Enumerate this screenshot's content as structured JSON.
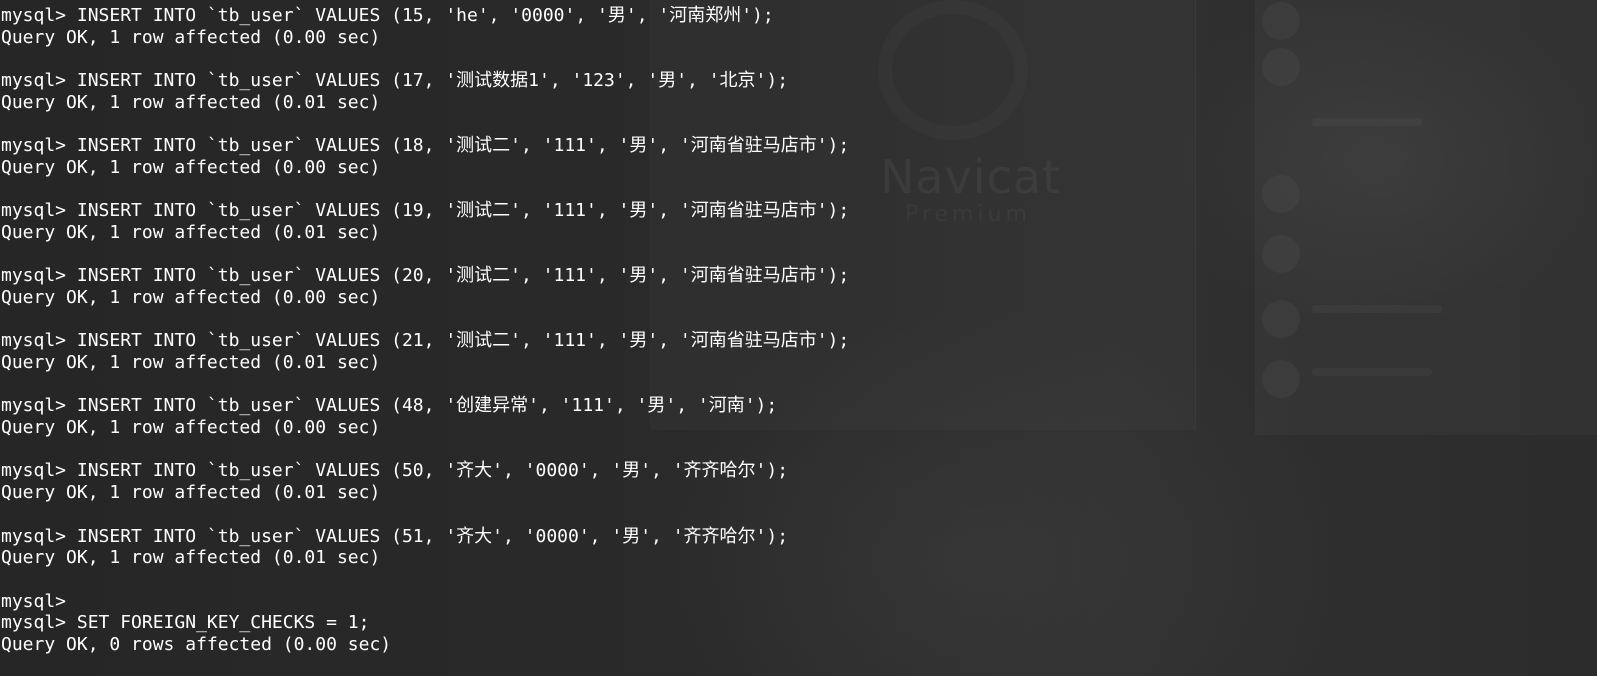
{
  "terminal": {
    "lines": [
      "mysql> INSERT INTO `tb_user` VALUES (15, 'he', '0000', '男', '河南郑州');",
      "Query OK, 1 row affected (0.00 sec)",
      "",
      "mysql> INSERT INTO `tb_user` VALUES (17, '测试数据1', '123', '男', '北京');",
      "Query OK, 1 row affected (0.01 sec)",
      "",
      "mysql> INSERT INTO `tb_user` VALUES (18, '测试二', '111', '男', '河南省驻马店市');",
      "Query OK, 1 row affected (0.00 sec)",
      "",
      "mysql> INSERT INTO `tb_user` VALUES (19, '测试二', '111', '男', '河南省驻马店市');",
      "Query OK, 1 row affected (0.01 sec)",
      "",
      "mysql> INSERT INTO `tb_user` VALUES (20, '测试二', '111', '男', '河南省驻马店市');",
      "Query OK, 1 row affected (0.00 sec)",
      "",
      "mysql> INSERT INTO `tb_user` VALUES (21, '测试二', '111', '男', '河南省驻马店市');",
      "Query OK, 1 row affected (0.01 sec)",
      "",
      "mysql> INSERT INTO `tb_user` VALUES (48, '创建异常', '111', '男', '河南');",
      "Query OK, 1 row affected (0.00 sec)",
      "",
      "mysql> INSERT INTO `tb_user` VALUES (50, '齐大', '0000', '男', '齐齐哈尔');",
      "Query OK, 1 row affected (0.01 sec)",
      "",
      "mysql> INSERT INTO `tb_user` VALUES (51, '齐大', '0000', '男', '齐齐哈尔');",
      "Query OK, 1 row affected (0.01 sec)",
      "",
      "mysql>",
      "mysql> SET FOREIGN_KEY_CHECKS = 1;",
      "Query OK, 0 rows affected (0.00 sec)"
    ]
  },
  "background": {
    "logo_text": "Navicat",
    "logo_sub": "Premium"
  },
  "colors": {
    "text": "#ffffff",
    "background": "#2b2b2b"
  }
}
